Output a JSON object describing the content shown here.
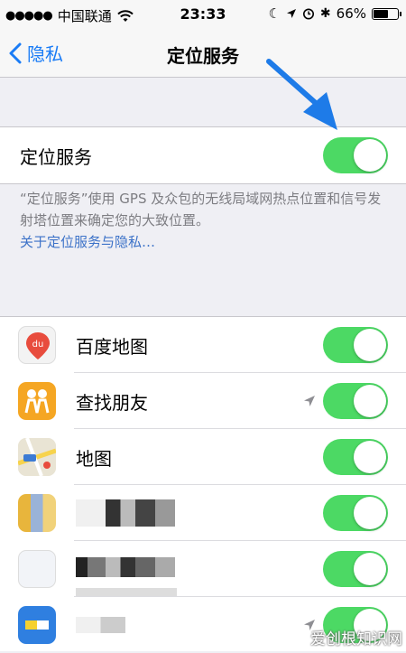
{
  "status_bar": {
    "carrier": "中国联通",
    "time": "23:33",
    "battery_percent": "66%",
    "battery_level": 0.66
  },
  "nav": {
    "back_label": "隐私",
    "title": "定位服务"
  },
  "main_toggle": {
    "label": "定位服务",
    "on": true
  },
  "description": {
    "text": "“定位服务”使用 GPS 及众包的无线局域网热点位置和信号发射塔位置来确定您的大致位置。",
    "link": "关于定位服务与隐私…"
  },
  "apps": [
    {
      "label": "百度地图",
      "on": true,
      "icon": "baidu-map-icon"
    },
    {
      "label": "查找朋友",
      "on": true,
      "icon": "find-friends-icon",
      "location_indicator": true
    },
    {
      "label": "地图",
      "on": true,
      "icon": "maps-icon"
    },
    {
      "label": "",
      "on": true,
      "icon": "blurred-app-icon"
    },
    {
      "label": "",
      "on": true,
      "icon": "blurred-app-icon"
    },
    {
      "label": "",
      "on": true,
      "icon": "blurred-app-icon",
      "location_indicator": true
    }
  ],
  "colors": {
    "accent": "#1a7cf6",
    "toggle_on": "#4cd964",
    "annotation_arrow": "#1e7be8"
  },
  "watermark": "爱创根知识网"
}
